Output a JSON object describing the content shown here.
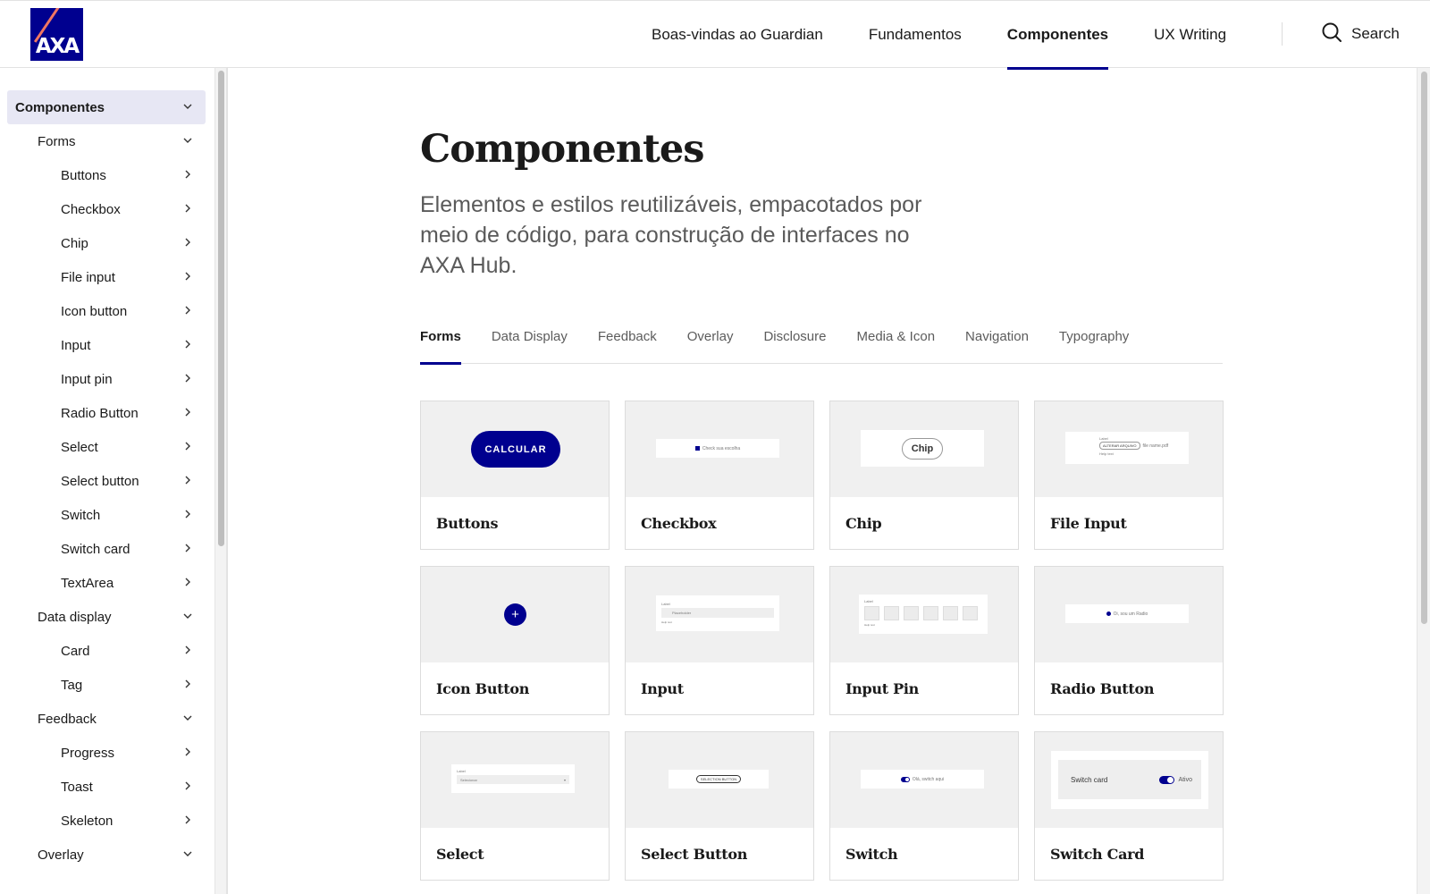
{
  "header": {
    "logo_text": "AXA",
    "nav": [
      {
        "label": "Boas-vindas ao Guardian",
        "active": false
      },
      {
        "label": "Fundamentos",
        "active": false
      },
      {
        "label": "Componentes",
        "active": true
      },
      {
        "label": "UX Writing",
        "active": false
      }
    ],
    "search_label": "Search",
    "search_icon": "search-icon"
  },
  "sidebar": {
    "items": [
      {
        "label": "Componentes",
        "level": 0,
        "icon": "chevron-down-icon"
      },
      {
        "label": "Forms",
        "level": 1,
        "icon": "chevron-down-icon"
      },
      {
        "label": "Buttons",
        "level": 2,
        "icon": "chevron-right-icon"
      },
      {
        "label": "Checkbox",
        "level": 2,
        "icon": "chevron-right-icon"
      },
      {
        "label": "Chip",
        "level": 2,
        "icon": "chevron-right-icon"
      },
      {
        "label": "File input",
        "level": 2,
        "icon": "chevron-right-icon"
      },
      {
        "label": "Icon button",
        "level": 2,
        "icon": "chevron-right-icon"
      },
      {
        "label": "Input",
        "level": 2,
        "icon": "chevron-right-icon"
      },
      {
        "label": "Input pin",
        "level": 2,
        "icon": "chevron-right-icon"
      },
      {
        "label": "Radio Button",
        "level": 2,
        "icon": "chevron-right-icon"
      },
      {
        "label": "Select",
        "level": 2,
        "icon": "chevron-right-icon"
      },
      {
        "label": "Select button",
        "level": 2,
        "icon": "chevron-right-icon"
      },
      {
        "label": "Switch",
        "level": 2,
        "icon": "chevron-right-icon"
      },
      {
        "label": "Switch card",
        "level": 2,
        "icon": "chevron-right-icon"
      },
      {
        "label": "TextArea",
        "level": 2,
        "icon": "chevron-right-icon"
      },
      {
        "label": "Data display",
        "level": 1,
        "icon": "chevron-down-icon"
      },
      {
        "label": "Card",
        "level": 2,
        "icon": "chevron-right-icon"
      },
      {
        "label": "Tag",
        "level": 2,
        "icon": "chevron-right-icon"
      },
      {
        "label": "Feedback",
        "level": 1,
        "icon": "chevron-down-icon"
      },
      {
        "label": "Progress",
        "level": 2,
        "icon": "chevron-right-icon"
      },
      {
        "label": "Toast",
        "level": 2,
        "icon": "chevron-right-icon"
      },
      {
        "label": "Skeleton",
        "level": 2,
        "icon": "chevron-right-icon"
      },
      {
        "label": "Overlay",
        "level": 1,
        "icon": "chevron-down-icon"
      }
    ]
  },
  "main": {
    "title": "Componentes",
    "description": "Elementos e estilos reutilizáveis, empacotados por meio de código, para construção de interfaces no AXA Hub.",
    "tabs": [
      {
        "label": "Forms",
        "active": true
      },
      {
        "label": "Data Display",
        "active": false
      },
      {
        "label": "Feedback",
        "active": false
      },
      {
        "label": "Overlay",
        "active": false
      },
      {
        "label": "Disclosure",
        "active": false
      },
      {
        "label": "Media & Icon",
        "active": false
      },
      {
        "label": "Navigation",
        "active": false
      },
      {
        "label": "Typography",
        "active": false
      }
    ],
    "cards": [
      {
        "title": "Buttons",
        "preview": "button",
        "preview_text": "CALCULAR"
      },
      {
        "title": "Checkbox",
        "preview": "checkbox",
        "preview_text": "Check sua escolha"
      },
      {
        "title": "Chip",
        "preview": "chip",
        "preview_text": "Chip"
      },
      {
        "title": "File Input",
        "preview": "file",
        "preview_text": "Label",
        "preview_button": "ALTERAR ARQUIVO",
        "preview_file": "file name.pdf",
        "preview_help": "Help text"
      },
      {
        "title": "Icon Button",
        "preview": "iconbutton",
        "preview_text": "+"
      },
      {
        "title": "Input",
        "preview": "input",
        "preview_text": "Label",
        "preview_placeholder": "Placeholder",
        "preview_help": "Help text"
      },
      {
        "title": "Input Pin",
        "preview": "pin",
        "preview_text": "Label",
        "preview_help": "Help text"
      },
      {
        "title": "Radio Button",
        "preview": "radio",
        "preview_text": "Oi, sou um Radio"
      },
      {
        "title": "Select",
        "preview": "select",
        "preview_text": "Label",
        "preview_placeholder": "Selecionar"
      },
      {
        "title": "Select Button",
        "preview": "selectbutton",
        "preview_text": "SELECTION BUTTON"
      },
      {
        "title": "Switch",
        "preview": "switch",
        "preview_text": "Olá, switch aqui"
      },
      {
        "title": "Switch Card",
        "preview": "switchcard",
        "preview_text": "Switch card",
        "preview_state": "Ativo"
      }
    ]
  },
  "colors": {
    "brand": "#00008f",
    "logo_accent": "#f07662",
    "sidebar_active_bg": "#e7e7f4"
  }
}
